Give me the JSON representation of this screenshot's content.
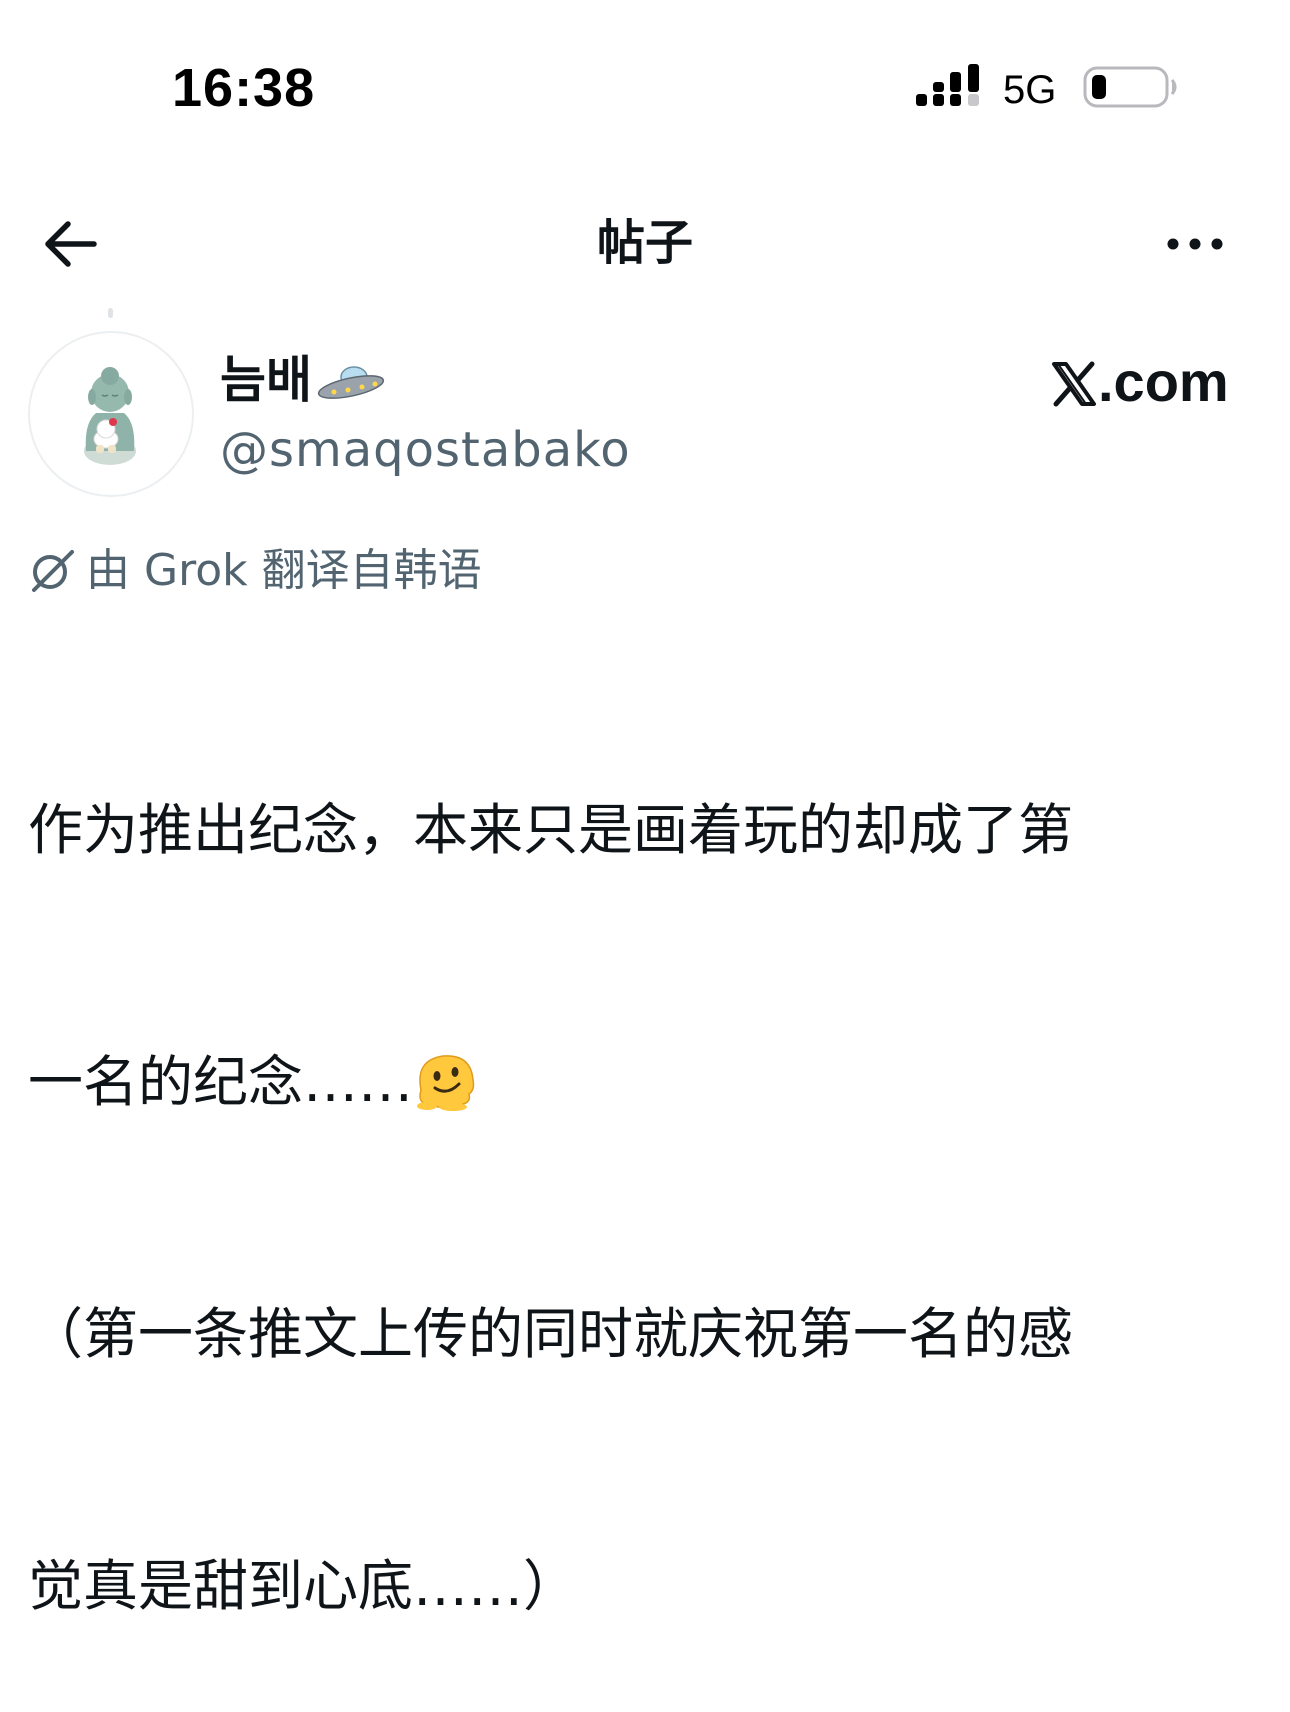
{
  "status_bar": {
    "time": "16:38",
    "network": "5G",
    "signal_icon": "signal-bars-icon",
    "battery_icon": "battery-low-icon"
  },
  "nav": {
    "title": "帖子",
    "back_icon": "arrow-left-icon",
    "more_icon": "more-horizontal-icon"
  },
  "author": {
    "display_name": "늠배",
    "name_emoji": "flying-saucer-emoji",
    "handle": "@smaqostabako",
    "avatar_icon": "buddha-figurine-avatar"
  },
  "watermark": {
    "text": ".com",
    "logo": "x-logo"
  },
  "translation": {
    "icon": "grok-icon",
    "label": "由 Grok 翻译自韩语"
  },
  "post": {
    "line1": "作为推出纪念，本来只是画着玩的却成了第",
    "line2": "一名的纪念……",
    "line2_emoji": "melting-face-emoji",
    "line3": "（第一条推文上传的同时就庆祝第一名的感",
    "line4": "觉真是甜到心底……）"
  },
  "colors": {
    "text_primary": "#0f1419",
    "text_secondary": "#536471",
    "background": "#ffffff"
  }
}
